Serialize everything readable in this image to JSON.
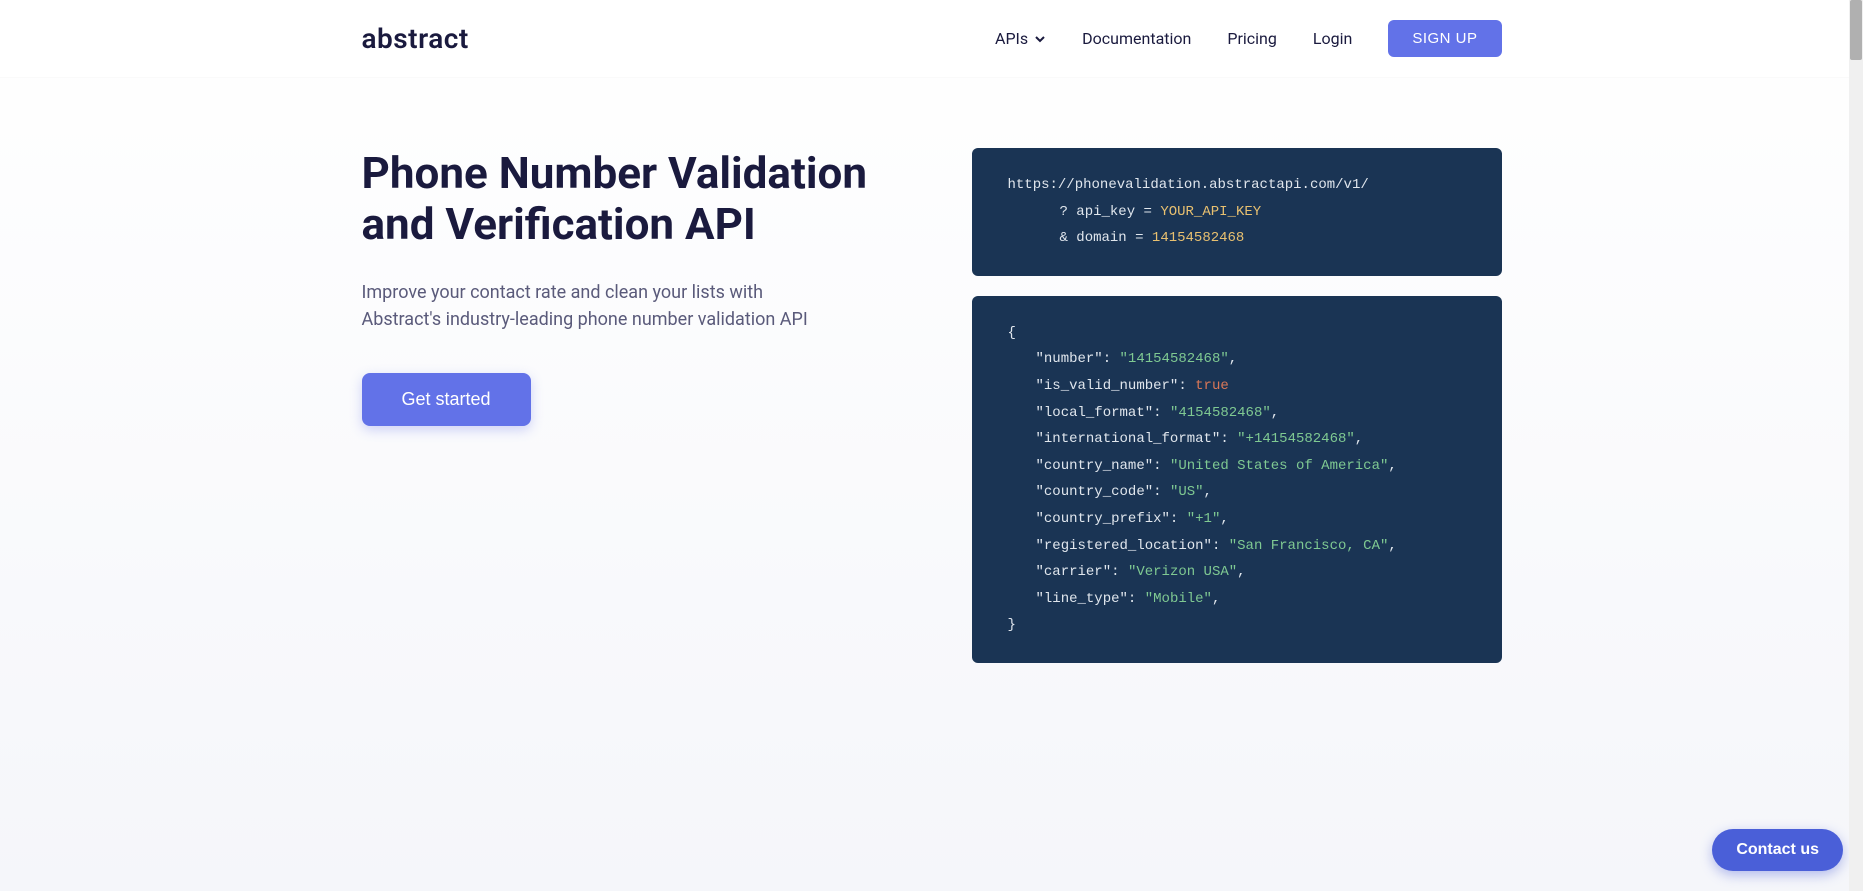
{
  "header": {
    "logo": "abstract",
    "nav": {
      "apis": "APIs",
      "documentation": "Documentation",
      "pricing": "Pricing",
      "login": "Login",
      "signup": "SIGN UP"
    }
  },
  "hero": {
    "title": "Phone Number Validation and Verification API",
    "subtitle": "Improve your contact rate and clean your lists with Abstract's industry-leading phone number validation API",
    "cta": "Get started"
  },
  "code_request": {
    "url": "https://phonevalidation.abstractapi.com/v1/",
    "param1_key": "? api_key =",
    "param1_val": "YOUR_API_KEY",
    "param2_key": "& domain =",
    "param2_val": "14154582468"
  },
  "code_response": {
    "open": "{",
    "close": "}",
    "lines": [
      {
        "key": "\"number\"",
        "sep": ": ",
        "val": "\"14154582468\"",
        "end": ",",
        "type": "string"
      },
      {
        "key": "\"is_valid_number\"",
        "sep": ": ",
        "val": "true",
        "end": "",
        "type": "bool"
      },
      {
        "key": "\"local_format\"",
        "sep": ": ",
        "val": "\"4154582468\"",
        "end": ",",
        "type": "string"
      },
      {
        "key": "\"international_format\"",
        "sep": ": ",
        "val": "\"+14154582468\"",
        "end": ",",
        "type": "string"
      },
      {
        "key": "\"country_name\"",
        "sep": ": ",
        "val": "\"United States of America\"",
        "end": ",",
        "type": "string"
      },
      {
        "key": "\"country_code\"",
        "sep": ": ",
        "val": "\"US\"",
        "end": ",",
        "type": "string"
      },
      {
        "key": "\"country_prefix\"",
        "sep": ": ",
        "val": "\"+1\"",
        "end": ",",
        "type": "string"
      },
      {
        "key": "\"registered_location\"",
        "sep": ": ",
        "val": "\"San Francisco, CA\"",
        "end": ",",
        "type": "string"
      },
      {
        "key": "\"carrier\"",
        "sep": ": ",
        "val": "\"Verizon USA\"",
        "end": ",",
        "type": "string"
      },
      {
        "key": "\"line_type\"",
        "sep": ": ",
        "val": "\"Mobile\"",
        "end": ",",
        "type": "string"
      }
    ]
  },
  "contact": "Contact us"
}
